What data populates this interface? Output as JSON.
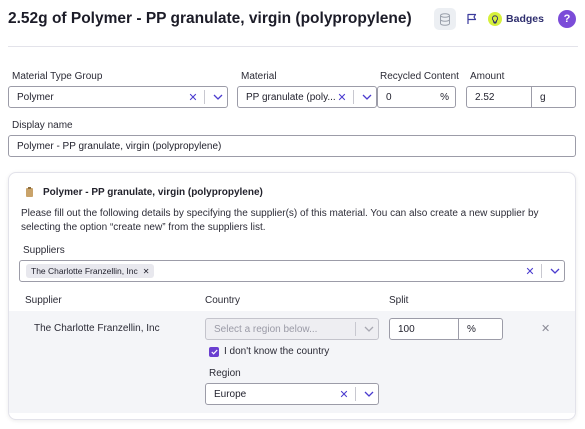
{
  "header": {
    "title": "2.52g of Polymer - PP granulate, virgin (polypropylene)",
    "badges_label": "Badges",
    "help_label": "?"
  },
  "form": {
    "material_type_group": {
      "label": "Material Type Group",
      "value": "Polymer"
    },
    "material": {
      "label": "Material",
      "value": "PP granulate (poly..."
    },
    "recycled_content": {
      "label": "Recycled Content",
      "value": "0",
      "unit": "%"
    },
    "amount": {
      "label": "Amount",
      "value": "2.52",
      "unit": "g"
    },
    "display_name": {
      "label": "Display name",
      "value": "Polymer - PP granulate, virgin (polypropylene)"
    }
  },
  "supplier_card": {
    "title": "Polymer - PP granulate, virgin (polypropylene)",
    "description": "Please fill out the following details by specifying the supplier(s) of this material. You can also create a new supplier by selecting the option “create new” from the suppliers list.",
    "suppliers_label": "Suppliers",
    "selected_supplier_chip": "The Charlotte Franzellin, Inc",
    "columns": {
      "supplier": "Supplier",
      "country": "Country",
      "split": "Split"
    },
    "rows": [
      {
        "supplier": "The Charlotte Franzellin, Inc",
        "country_placeholder": "Select a region below...",
        "dont_know_country": "I don't know the country",
        "dont_know_checked": true,
        "region_label": "Region",
        "region_value": "Europe",
        "split_value": "100",
        "split_unit": "%"
      }
    ]
  },
  "colors": {
    "accent": "#4b3ccf",
    "help": "#7b4cd8",
    "badge": "#d6f03c",
    "checkbox": "#6a3fd0"
  }
}
